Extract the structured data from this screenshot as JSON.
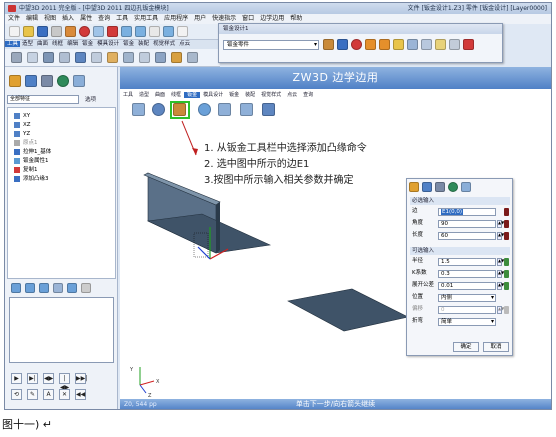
{
  "window": {
    "title": "中望3D 2011 完全版 - [中望3D 2011 四边孔钣金模块]",
    "right_info": "文件 [钣金设计1.Z3]  零件 [钣金设计]  [Layer0000]"
  },
  "menubar": {
    "items": [
      "文件",
      "编辑",
      "视图",
      "插入",
      "属性",
      "查询",
      "工具",
      "实用工具",
      "应用程序",
      "用户",
      "快速指示",
      "窗口",
      "边学边用",
      "帮助"
    ]
  },
  "ribbon": {
    "tabs": [
      "工具",
      "造型",
      "曲面",
      "线框",
      "编辑",
      "钣金",
      "模具设计",
      "钣金",
      "装配",
      "视觉样式",
      "点云"
    ],
    "active_tab_index": 0
  },
  "float_bar": {
    "title": "钣金设计1",
    "combo_value": "钣金零件"
  },
  "left_panel": {
    "combo_value": "全部特征",
    "combo_label": "选项",
    "tree": [
      "XY",
      "XZ",
      "YZ",
      "原点1",
      "拉伸1_基体",
      "钣金属性1",
      "复制1",
      "添加凸缘3"
    ],
    "buttons": [
      "▶",
      "▶|",
      "◀▶",
      "|◀▶",
      "▶▶|",
      "⟲",
      "✎",
      "A",
      "✕",
      "◀◀"
    ]
  },
  "viewport": {
    "banner": "ZW3D 边学边用",
    "tabs": [
      "工具",
      "造型",
      "曲面",
      "线框",
      "钣金",
      "模具设计",
      "钣金",
      "装配",
      "视觉样式",
      "点云",
      "查询"
    ],
    "active_tab_index": 4,
    "instructions": [
      "1. 从钣金工具栏中选择添加凸缘命令",
      "2. 选中图中所示的边E1",
      "3.按图中所示输入相关参数并确定"
    ]
  },
  "dialog": {
    "section_required": "必选输入",
    "edge_label": "边",
    "edge_value": "E1(0,0)",
    "angle_label": "角度",
    "angle_value": "90",
    "length_label": "长度",
    "length_value": "60",
    "section_optional": "可选输入",
    "radius_label": "半径",
    "radius_value": "1.5",
    "kfactor_label": "K系数",
    "kfactor_value": "0.3",
    "tolerance_label": "展开公差",
    "tolerance_value": "0.01",
    "position_label": "位置",
    "position_value": "内侧",
    "offset_label": "偏移",
    "offset_value": "0",
    "relief_label": "折弯",
    "relief_value": "简单",
    "ok_label": "确定",
    "cancel_label": "取消"
  },
  "statusbar": {
    "coord": "Z0, 544 pp",
    "hint": "单击下一步/向右箭头继续"
  },
  "caption": "图十一) ↵"
}
